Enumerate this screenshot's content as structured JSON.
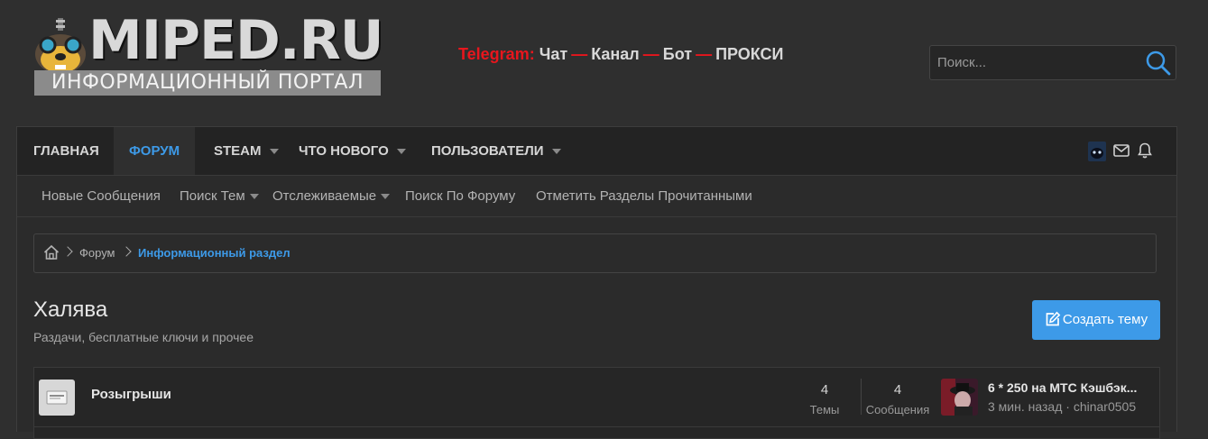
{
  "header": {
    "logo": {
      "title": "MIPED.RU",
      "subtitle": "ИНФОРМАЦИОННЫЙ ПОРТАЛ"
    },
    "telegram": {
      "label": "Telegram:",
      "links": [
        "Чат",
        "Канал",
        "Бот",
        "ПРОКСИ"
      ],
      "separator": "—"
    },
    "search": {
      "placeholder": "Поиск...",
      "icon": "search-icon"
    }
  },
  "nav": {
    "tabs": [
      {
        "label": "ГЛАВНАЯ",
        "active": false,
        "dropdown": false
      },
      {
        "label": "ФОРУМ",
        "active": true,
        "dropdown": false
      },
      {
        "label": "STEAM",
        "active": false,
        "dropdown": true
      },
      {
        "label": "ЧТО НОВОГО",
        "active": false,
        "dropdown": true
      },
      {
        "label": "ПОЛЬЗОВАТЕЛИ",
        "active": false,
        "dropdown": true
      }
    ],
    "icons": [
      "user-avatar",
      "envelope-icon",
      "bell-icon"
    ],
    "subnav": [
      {
        "label": "Новые Сообщения",
        "dropdown": false
      },
      {
        "label": "Поиск Тем",
        "dropdown": true
      },
      {
        "label": "Отслеживаемые",
        "dropdown": true
      },
      {
        "label": "Поиск По Форуму",
        "dropdown": false
      },
      {
        "label": "Отметить Разделы Прочитанными",
        "dropdown": false
      }
    ]
  },
  "breadcrumb": {
    "home_icon": "home-icon",
    "items": [
      "Форум",
      "Информационный раздел"
    ]
  },
  "page": {
    "title": "Халява",
    "description": "Раздачи, бесплатные ключи и прочее",
    "create_button": "Создать тему"
  },
  "forums": [
    {
      "name": "Розыгрыши",
      "threads_value": "4",
      "threads_label": "Темы",
      "messages_value": "4",
      "messages_label": "Сообщения",
      "last_post": {
        "title": "6 * 250 на МТС Кэшбэк...",
        "time": "3 мин. назад",
        "separator": "·",
        "user": "chinar0505"
      }
    }
  ],
  "colors": {
    "accent": "#3d9ae8",
    "telegram_red": "#e8161d",
    "background": "#2f2f2f"
  }
}
